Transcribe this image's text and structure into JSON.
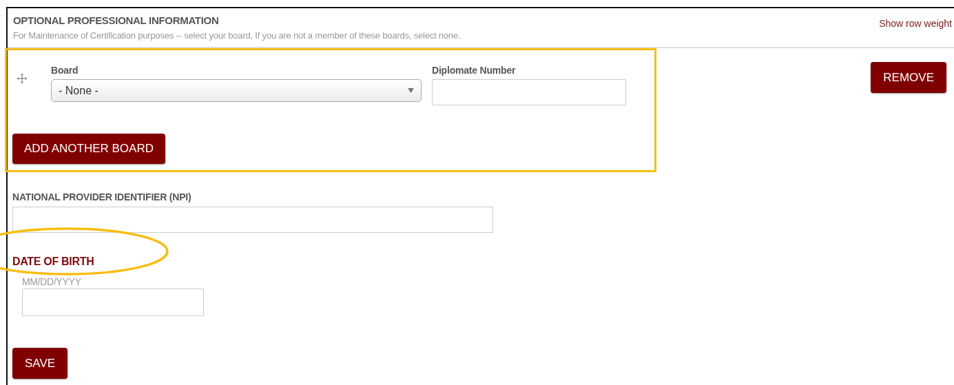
{
  "section": {
    "title": "OPTIONAL PROFESSIONAL INFORMATION",
    "description": "For Maintenance of Certification purposes -- select your board, If you are not a member of these boards, select none.",
    "link": "Show row weight"
  },
  "board_rows": [
    {
      "board_label": "Board",
      "board_value": "- None -",
      "number_label": "Diplomate Number",
      "remove": "REMOVE"
    }
  ],
  "add_button": "ADD ANOTHER BOARD",
  "npi": {
    "label": "NATIONAL PROVIDER IDENTIFIER (NPI)"
  },
  "date_of_birth": {
    "label": "DATE OF BIRTH",
    "hint": "MM/DD/YYYY"
  },
  "save_button": "SAVE",
  "annotations": [
    {
      "kind": "rectangle"
    },
    {
      "kind": "ellipse"
    }
  ]
}
